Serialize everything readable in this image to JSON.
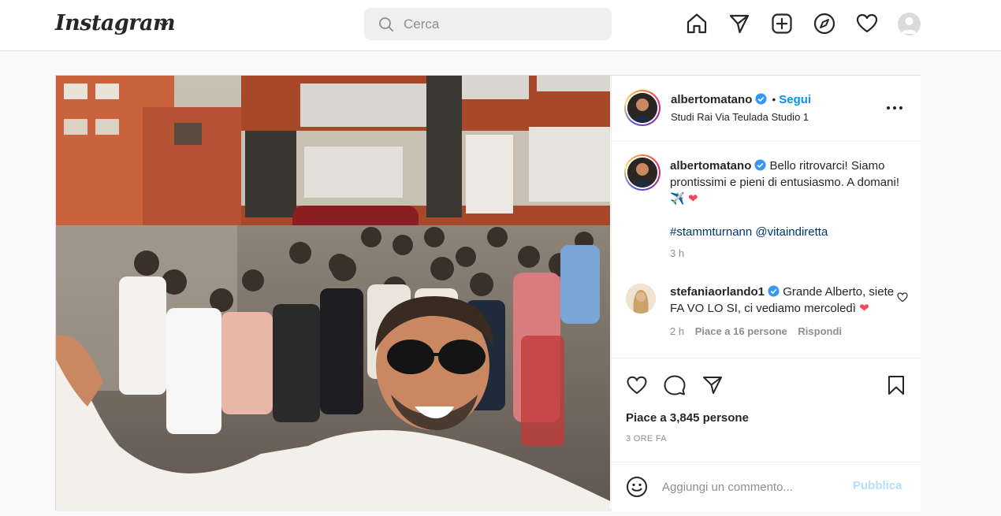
{
  "app": {
    "logo_text": "Instagram",
    "search": {
      "placeholder": "Cerca",
      "value": ""
    },
    "nav_icons": [
      "home-icon",
      "direct-message-icon",
      "new-post-icon",
      "explore-icon",
      "activity-heart-icon",
      "profile-avatar"
    ]
  },
  "post": {
    "author": {
      "username": "albertomatano",
      "verified": true,
      "follow_label": "Segui",
      "separator": "•",
      "location": "Studi Rai Via Teulada Studio 1"
    },
    "caption": {
      "username": "albertomatano",
      "text": "Bello ritrovarci! Siamo prontissimi e pieni di entusiasmo. A domani! ✈️",
      "heart": "❤",
      "hashtags": "#stammturnann @vitaindiretta",
      "time_ago": "3 h"
    },
    "comment": {
      "username": "stefaniaorlando1",
      "verified": true,
      "text": "Grande Alberto, siete FA VO LO SI, ci vediamo mercoledì",
      "heart": "❤",
      "time_ago": "2 h",
      "likes_label": "Piace a 16 persone",
      "reply_label": "Rispondi"
    },
    "likes_label": "Piace a 3,845 persone",
    "timestamp": "3 ORE FA",
    "add_comment": {
      "placeholder": "Aggiungi un commento...",
      "value": ""
    },
    "publish_label": "Pubblica"
  },
  "colors": {
    "link_blue": "#0095f6",
    "hashtag_blue": "#00376b",
    "publish_disabled": "#b2dffc",
    "heart_red": "#ed4956",
    "verified_blue": "#3897f0"
  }
}
